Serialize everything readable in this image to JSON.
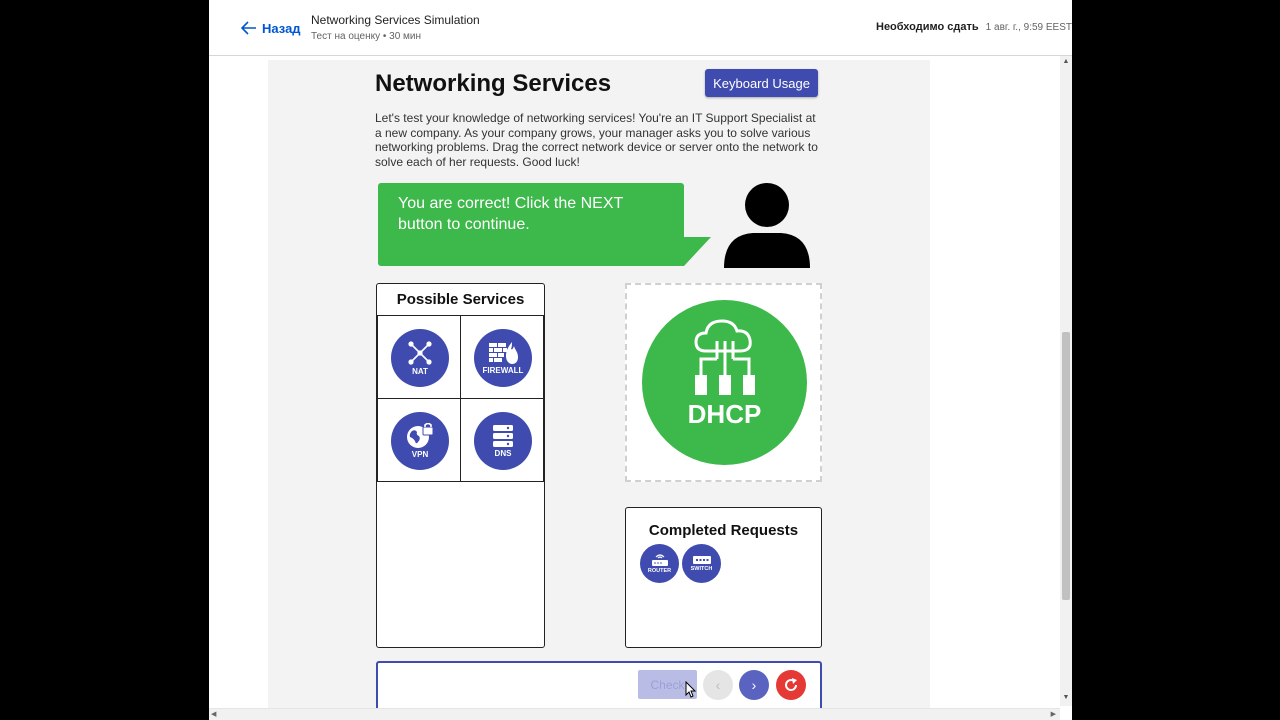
{
  "header": {
    "back_label": "Назад",
    "course_title": "Networking Services Simulation",
    "course_subtitle": "Тест на оценку • 30 мин",
    "due_label": "Необходимо сдать",
    "due_date": "1 авг. г., 9:59 EEST"
  },
  "sim": {
    "title": "Networking Services",
    "keyboard_button": "Keyboard Usage",
    "intro": "Let's test your knowledge of networking services! You're an IT Support Specialist at a new company. As your company grows, your manager asks you to solve various networking problems. Drag the correct network device or server onto the network to solve each of her requests. Good luck!",
    "feedback": "You are correct! Click the NEXT button to continue.",
    "services_title": "Possible Services",
    "services": [
      {
        "label": "NAT",
        "icon": "nat-icon"
      },
      {
        "label": "FIREWALL",
        "icon": "firewall-icon"
      },
      {
        "label": "VPN",
        "icon": "vpn-icon"
      },
      {
        "label": "DNS",
        "icon": "dns-icon"
      }
    ],
    "dropped": {
      "label": "DHCP",
      "icon": "dhcp-icon"
    },
    "completed_title": "Completed Requests",
    "completed": [
      {
        "label": "ROUTER",
        "icon": "router-icon"
      },
      {
        "label": "SWITCH",
        "icon": "switch-icon"
      }
    ],
    "check_label": "Check",
    "prev_symbol": "‹",
    "next_symbol": "›"
  },
  "colors": {
    "primary": "#3f4baf",
    "success": "#3db84a",
    "danger": "#e53935",
    "link": "#0056d2"
  }
}
